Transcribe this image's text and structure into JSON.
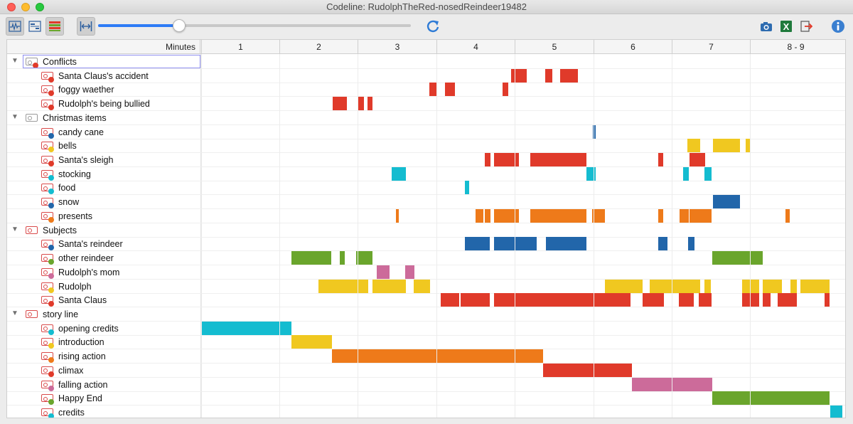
{
  "window": {
    "title": "Codeline: RudolphTheRed-nosedReindeer19482"
  },
  "toolbar": {
    "buttons": [
      {
        "name": "view-waveform-button",
        "icon": "waveform-icon"
      },
      {
        "name": "view-list-button",
        "icon": "list-icon"
      },
      {
        "name": "view-colors-button",
        "icon": "color-bars-icon"
      },
      {
        "name": "fit-width-button",
        "icon": "fit-width-icon"
      }
    ],
    "zoom_fraction": 0.26,
    "right_buttons": [
      "camera-icon",
      "excel-icon",
      "export-icon",
      "info-icon"
    ]
  },
  "header": {
    "minutes_label": "Minutes",
    "columns": [
      "1",
      "2",
      "3",
      "4",
      "5",
      "6",
      "7",
      "8 - 9"
    ]
  },
  "colors": {
    "red": "#e03a2a",
    "blue": "#2266aa",
    "yellow": "#f0c820",
    "cyan": "#14bcd0",
    "orange": "#ee7a1a",
    "green": "#6aa52c",
    "pink": "#cc6b9a",
    "gray": "#9a9a9a"
  },
  "rows": [
    {
      "label": "Conflicts",
      "level": 0,
      "dot": "red",
      "icon": "gray",
      "segments": []
    },
    {
      "label": "Santa Claus's accident",
      "level": 1,
      "dot": "red",
      "segments": [
        [
          718,
          740
        ],
        [
          766,
          776
        ],
        [
          787,
          812
        ]
      ]
    },
    {
      "label": "foggy waether",
      "level": 1,
      "dot": "red",
      "segments": [
        [
          603,
          613
        ],
        [
          625,
          639
        ],
        [
          706,
          714
        ]
      ]
    },
    {
      "label": "Rudolph's being bullied",
      "level": 1,
      "dot": "red",
      "segments": [
        [
          467,
          487
        ],
        [
          502,
          511
        ],
        [
          516,
          523
        ]
      ]
    },
    {
      "label": "Christmas items",
      "level": 0,
      "dot": null,
      "icon": "gray",
      "segments": []
    },
    {
      "label": "candy cane",
      "level": 1,
      "dot": "blue",
      "segments": [
        [
          833,
          837
        ]
      ]
    },
    {
      "label": "bells",
      "level": 1,
      "dot": "yellow",
      "segments": [
        [
          966,
          984
        ],
        [
          1002,
          1040
        ],
        [
          1048,
          1055
        ]
      ]
    },
    {
      "label": "Santa's sleigh",
      "level": 1,
      "dot": "red",
      "segments": [
        [
          681,
          689
        ],
        [
          694,
          729
        ],
        [
          745,
          824
        ],
        [
          925,
          932
        ],
        [
          969,
          991
        ]
      ]
    },
    {
      "label": "stocking",
      "level": 1,
      "dot": "cyan",
      "segments": [
        [
          550,
          570
        ],
        [
          824,
          837
        ],
        [
          960,
          968
        ],
        [
          990,
          1000
        ]
      ]
    },
    {
      "label": "food",
      "level": 1,
      "dot": "cyan",
      "segments": [
        [
          653,
          659
        ]
      ]
    },
    {
      "label": "snow",
      "level": 1,
      "dot": "blue",
      "segments": [
        [
          1002,
          1040
        ]
      ]
    },
    {
      "label": "presents",
      "level": 1,
      "dot": "orange",
      "segments": [
        [
          556,
          560
        ],
        [
          668,
          679
        ],
        [
          681,
          689
        ],
        [
          694,
          729
        ],
        [
          745,
          824
        ],
        [
          832,
          850
        ],
        [
          925,
          932
        ],
        [
          955,
          968
        ],
        [
          969,
          1000
        ],
        [
          1104,
          1110
        ]
      ]
    },
    {
      "label": "Subjects",
      "level": 0,
      "dot": null,
      "icon": "red",
      "segments": []
    },
    {
      "label": "Santa's reindeer",
      "level": 1,
      "dot": "blue",
      "segments": [
        [
          653,
          688
        ],
        [
          694,
          754
        ],
        [
          767,
          824
        ],
        [
          925,
          938
        ],
        [
          967,
          976
        ]
      ]
    },
    {
      "label": "other reindeer",
      "level": 1,
      "dot": "green",
      "segments": [
        [
          409,
          465
        ],
        [
          477,
          484
        ],
        [
          500,
          523
        ],
        [
          1001,
          1072
        ]
      ]
    },
    {
      "label": "Rudolph's mom",
      "level": 1,
      "dot": "pink",
      "segments": [
        [
          529,
          547
        ],
        [
          569,
          582
        ]
      ]
    },
    {
      "label": "Rudolph",
      "level": 1,
      "dot": "yellow",
      "segments": [
        [
          447,
          517
        ],
        [
          523,
          570
        ],
        [
          581,
          604
        ],
        [
          850,
          903
        ],
        [
          913,
          984
        ],
        [
          990,
          999
        ],
        [
          1043,
          1067
        ],
        [
          1072,
          1099
        ],
        [
          1111,
          1120
        ],
        [
          1125,
          1166
        ]
      ]
    },
    {
      "label": "Santa Claus",
      "level": 1,
      "dot": "red",
      "segments": [
        [
          619,
          645
        ],
        [
          647,
          688
        ],
        [
          694,
          886
        ],
        [
          903,
          933
        ],
        [
          954,
          975
        ],
        [
          982,
          1000
        ],
        [
          1043,
          1067
        ],
        [
          1072,
          1083
        ],
        [
          1093,
          1120
        ],
        [
          1159,
          1166
        ]
      ]
    },
    {
      "label": "story line",
      "level": 0,
      "dot": null,
      "icon": "red",
      "segments": []
    },
    {
      "label": "opening credits",
      "level": 1,
      "dot": "cyan",
      "segments": [
        [
          282,
          409
        ]
      ]
    },
    {
      "label": "introduction",
      "level": 1,
      "dot": "yellow",
      "segments": [
        [
          409,
          466
        ]
      ]
    },
    {
      "label": "rising action",
      "level": 1,
      "dot": "orange",
      "segments": [
        [
          466,
          763
        ]
      ]
    },
    {
      "label": "climax",
      "level": 1,
      "dot": "red",
      "segments": [
        [
          763,
          888
        ]
      ]
    },
    {
      "label": "falling action",
      "level": 1,
      "dot": "pink",
      "segments": [
        [
          888,
          1001
        ]
      ]
    },
    {
      "label": "Happy End",
      "level": 1,
      "dot": "green",
      "segments": [
        [
          1001,
          1166
        ]
      ]
    },
    {
      "label": "credits",
      "level": 1,
      "dot": "cyan",
      "segments": [
        [
          1167,
          1184
        ]
      ]
    }
  ]
}
